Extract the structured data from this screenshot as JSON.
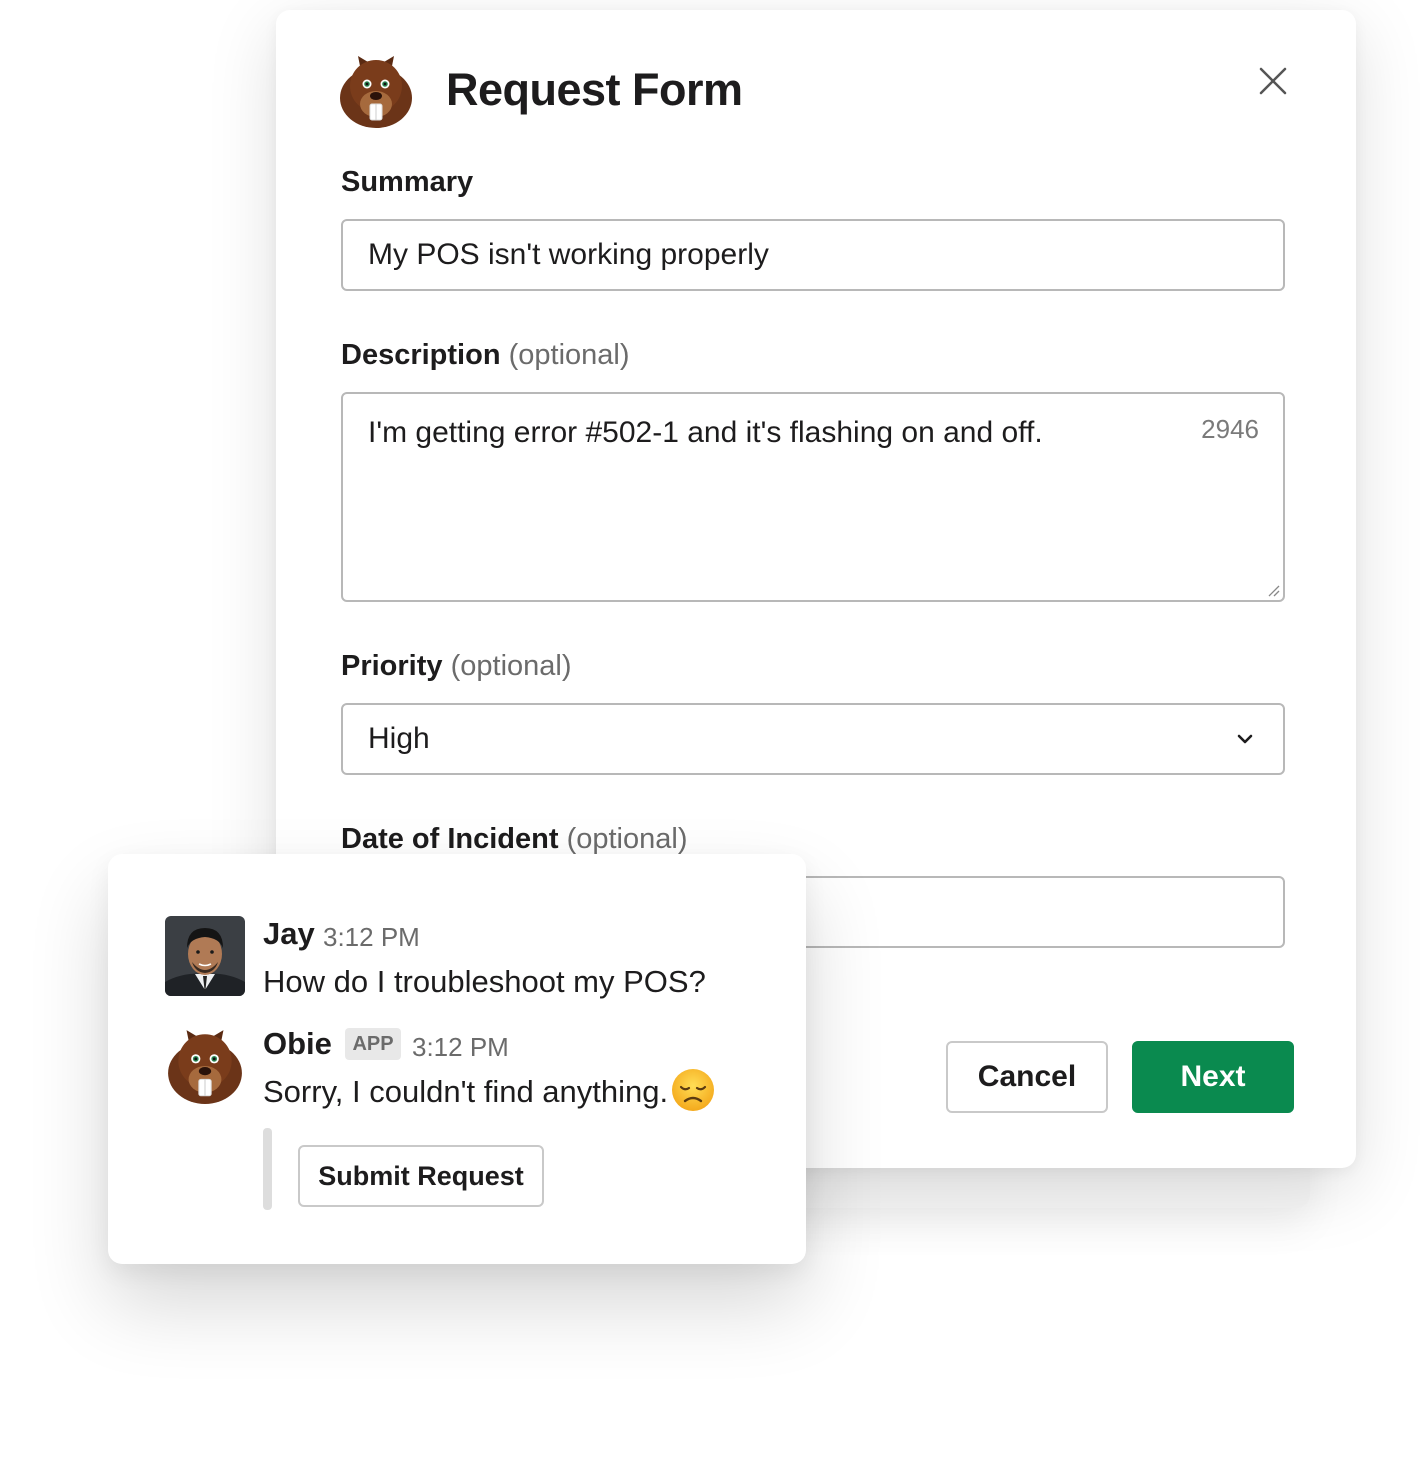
{
  "modal": {
    "title": "Request Form",
    "logo_icon": "beaver-logo-icon",
    "close_icon": "close-icon",
    "fields": {
      "summary": {
        "label": "Summary",
        "value": "My POS isn't working properly"
      },
      "description": {
        "label": "Description",
        "optional": "(optional)",
        "value": "I'm getting error #502-1 and it's flashing on and off.",
        "char_count": "2946"
      },
      "priority": {
        "label": "Priority",
        "optional": "(optional)",
        "value": "High"
      },
      "date": {
        "label": "Date of Incident",
        "optional": "(optional)",
        "value": ""
      }
    },
    "buttons": {
      "cancel": "Cancel",
      "next": "Next"
    },
    "colors": {
      "primary": "#0a8a4f",
      "border": "#b8b8b8"
    }
  },
  "chat": {
    "messages": [
      {
        "author": "Jay",
        "time": "3:12 PM",
        "text": "How do I troubleshoot my POS?",
        "avatar": "user-avatar"
      },
      {
        "author": "Obie",
        "badge": "APP",
        "time": "3:12 PM",
        "text": "Sorry, I couldn't find anything.",
        "avatar": "beaver-avatar",
        "emoji": "disappointed-face-icon"
      }
    ],
    "action_button": "Submit Request"
  }
}
